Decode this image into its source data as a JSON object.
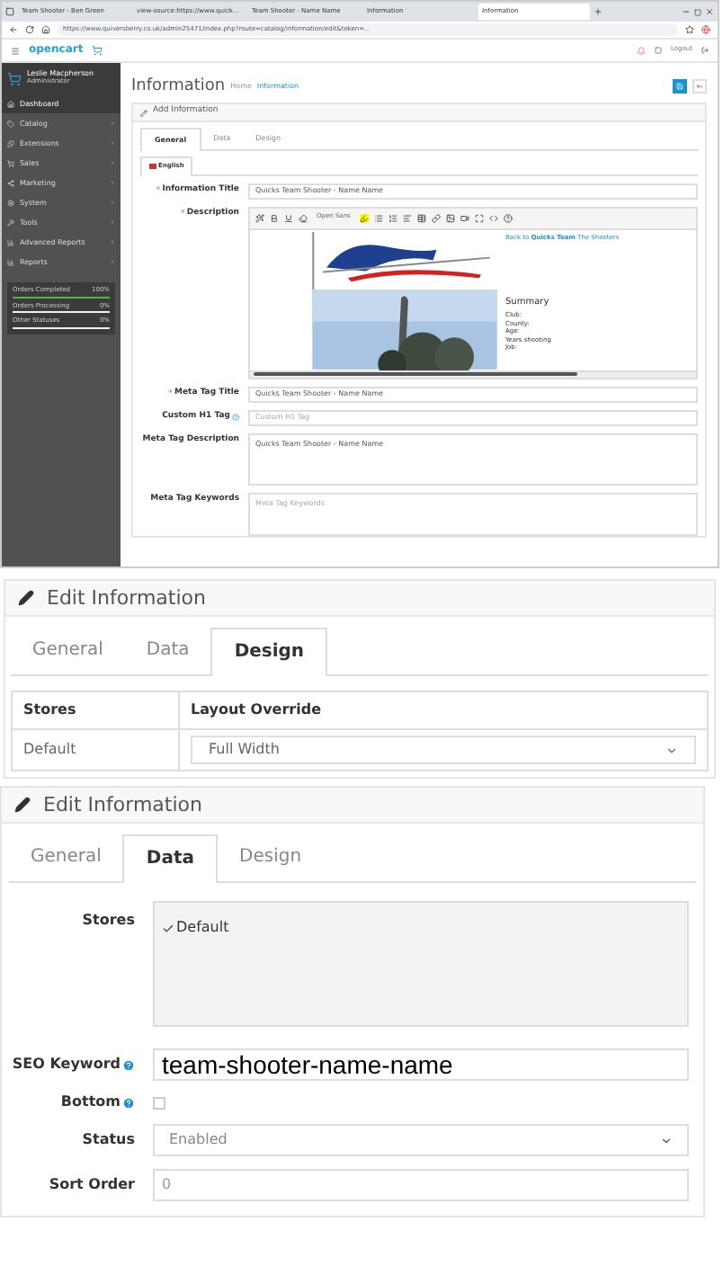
{
  "browser": {
    "tabs": [
      {
        "title": "Team Shooter - Ben Green",
        "selected": false
      },
      {
        "title": "view-source:https://www.quick...",
        "selected": false
      },
      {
        "title": "Team Shooter - Name Name",
        "selected": false
      },
      {
        "title": "Information",
        "selected": false
      },
      {
        "title": "Information",
        "selected": true
      }
    ],
    "url": "https://www.quiversberry.co.uk/admin25471/index.php?route=catalog/information/edit&token=..."
  },
  "header": {
    "logo": "opencart",
    "logout": "Logout"
  },
  "sidebar": {
    "user": {
      "name": "Leslie Macpherson",
      "role": "Administrator"
    },
    "items": [
      {
        "label": "Dashboard",
        "selected": true,
        "expandable": false
      },
      {
        "label": "Catalog",
        "selected": false,
        "expandable": true
      },
      {
        "label": "Extensions",
        "selected": false,
        "expandable": true
      },
      {
        "label": "Sales",
        "selected": false,
        "expandable": true
      },
      {
        "label": "Marketing",
        "selected": false,
        "expandable": true
      },
      {
        "label": "System",
        "selected": false,
        "expandable": true
      },
      {
        "label": "Tools",
        "selected": false,
        "expandable": true
      },
      {
        "label": "Advanced Reports",
        "selected": false,
        "expandable": true
      },
      {
        "label": "Reports",
        "selected": false,
        "expandable": true
      }
    ],
    "stats": [
      {
        "label": "Orders Completed",
        "value": "100%",
        "level": 1
      },
      {
        "label": "Orders Processing",
        "value": "0%",
        "level": 0
      },
      {
        "label": "Other Statuses",
        "value": "0%",
        "level": 0
      }
    ]
  },
  "page": {
    "title": "Information",
    "breadcrumbs": [
      "Home",
      "Information"
    ]
  },
  "form_panel": {
    "heading": "Add Information",
    "tabs": [
      {
        "label": "General",
        "selected": true
      },
      {
        "label": "Data",
        "selected": false
      },
      {
        "label": "Design",
        "selected": false
      }
    ],
    "language_tab": "English",
    "fields": [
      {
        "label": "Information Title",
        "required_mark": "*",
        "help": false,
        "kind": "text",
        "value": "Quicks Team Shooter - Name Name"
      },
      {
        "label": "Description",
        "required_mark": "*",
        "help": false,
        "kind": "editor"
      },
      {
        "label": "Meta Tag Title",
        "required_mark": "*",
        "help": false,
        "kind": "text",
        "value": "Quicks Team Shooter - Name Name"
      },
      {
        "label": "Custom H1 Tag",
        "help": true,
        "kind": "text",
        "placeholder": "Custom H1 Tag"
      },
      {
        "label": "Meta Tag Description",
        "help": false,
        "kind": "textarea",
        "value": "Quicks Team Shooter - Name Name"
      },
      {
        "label": "Meta Tag Keywords",
        "help": false,
        "kind": "textarea",
        "placeholder": "Meta Tag Keywords"
      }
    ],
    "editor": {
      "font": "Open Sans",
      "link": "Back to **Quicks Team** The Shooters",
      "summary_title": "Summary",
      "summary_lines": [
        "Club:",
        "County:",
        "Age:",
        "Years shooting",
        "Job:"
      ]
    }
  },
  "design_panel": {
    "heading": "Edit Information",
    "tabs": [
      {
        "label": "General",
        "selected": false
      },
      {
        "label": "Data",
        "selected": false
      },
      {
        "label": "Design",
        "selected": true
      }
    ],
    "columns": [
      "Stores",
      "Layout Override"
    ],
    "rows": [
      {
        "store": "Default",
        "layout": "Full Width"
      }
    ]
  },
  "data_panel": {
    "heading": "Edit Information",
    "tabs": [
      {
        "label": "General",
        "selected": false
      },
      {
        "label": "Data",
        "selected": true
      },
      {
        "label": "Design",
        "selected": false
      }
    ],
    "stores_label": "Stores",
    "stores": [
      {
        "label": "Default",
        "checked": true
      }
    ],
    "fields": [
      {
        "label": "SEO Keyword",
        "help": true,
        "kind": "text",
        "value": "team-shooter-name-name"
      },
      {
        "label": "Bottom",
        "help": true,
        "kind": "checkbox",
        "checked": false
      },
      {
        "label": "Status",
        "help": false,
        "kind": "select",
        "value": "Enabled"
      },
      {
        "label": "Sort Order",
        "help": false,
        "kind": "text",
        "value": "0"
      }
    ]
  }
}
